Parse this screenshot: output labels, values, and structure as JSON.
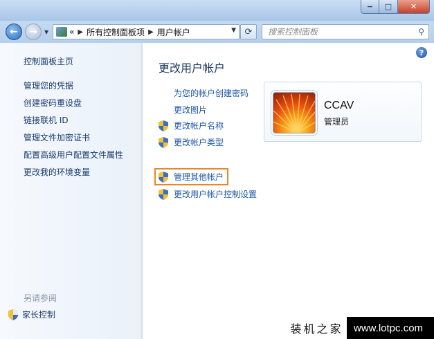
{
  "window": {
    "controls": {
      "minimize": "−",
      "maximize": "□",
      "close": "✕"
    }
  },
  "navbar": {
    "back_icon": "arrow-left-icon",
    "forward_icon": "arrow-right-icon",
    "overflow": "«",
    "breadcrumb": [
      "所有控制面板项",
      "用户帐户"
    ],
    "search_placeholder": "搜索控制面板"
  },
  "sidebar": {
    "items": [
      {
        "label": "控制面板主页"
      },
      {
        "label": "管理您的凭据"
      },
      {
        "label": "创建密码重设盘"
      },
      {
        "label": "链接联机 ID"
      },
      {
        "label": "管理文件加密证书"
      },
      {
        "label": "配置高级用户配置文件属性"
      },
      {
        "label": "更改我的环境变量"
      }
    ],
    "see_also": "另请参阅",
    "parental_control": "家长控制"
  },
  "main": {
    "title": "更改用户帐户",
    "tasks": [
      {
        "label": "为您的帐户创建密码",
        "shield": false
      },
      {
        "label": "更改图片",
        "shield": false
      },
      {
        "label": "更改帐户名称",
        "shield": true
      },
      {
        "label": "更改帐户类型",
        "shield": true
      },
      {
        "label": "管理其他帐户",
        "shield": true,
        "highlighted": true
      },
      {
        "label": "更改用户帐户控制设置",
        "shield": true
      }
    ],
    "user": {
      "name": "CCAV",
      "role": "管理员"
    },
    "help": "?"
  },
  "watermark": {
    "text": "装机之家",
    "url": "www.lotpc.com"
  },
  "colors": {
    "link": "#1a55a8",
    "highlight_border": "#e8862a",
    "sidebar_link": "#1a3a6b"
  }
}
